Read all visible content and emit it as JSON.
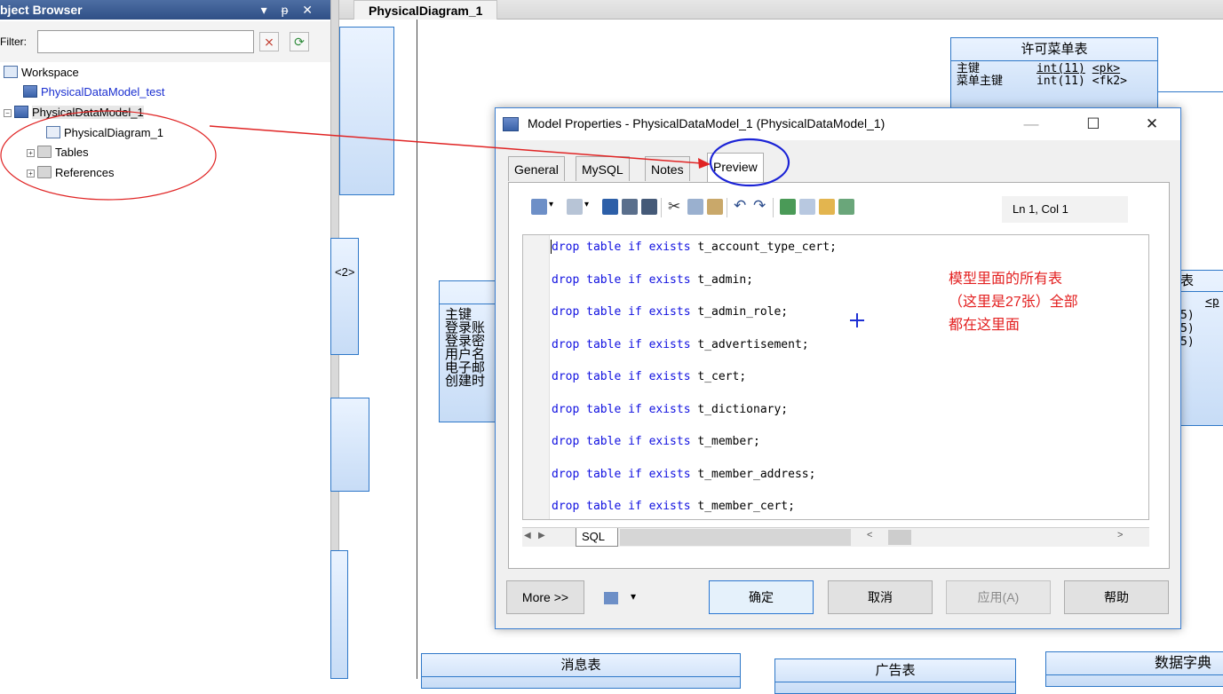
{
  "object_browser": {
    "title": "bject Browser",
    "title_controls": "▾ ᵽ ✕",
    "filter_label": "Filter:",
    "filter_value": "",
    "tree": [
      {
        "label": "Workspace",
        "style": "normal"
      },
      {
        "label": "PhysicalDataModel_test",
        "style": "blue"
      },
      {
        "label": "PhysicalDataModel_1",
        "style": "selected"
      },
      {
        "label": "PhysicalDiagram_1",
        "style": "normal"
      },
      {
        "label": "Tables",
        "style": "normal"
      },
      {
        "label": "References",
        "style": "normal"
      }
    ]
  },
  "diagram": {
    "tab_label": "PhysicalDiagram_1",
    "entities": {
      "permission_menu": {
        "title": "许可菜单表",
        "rows": [
          {
            "name": "主键",
            "type": "int(11)",
            "key": "<pk>"
          },
          {
            "name": "菜单主键",
            "type": "int(11)",
            "key": "<fk2>"
          }
        ]
      },
      "admin": {
        "rows": [
          "主键",
          "登录账",
          "登录密",
          "用户名",
          "电子邮",
          "创建时"
        ]
      },
      "right_partial": {
        "title": "表",
        "rows": [
          "<p",
          "5)",
          "5)",
          "5)"
        ]
      },
      "message": {
        "title": "消息表"
      },
      "advert": {
        "title": "广告表"
      },
      "dictionary": {
        "title": "数据字典"
      },
      "left_fragment": {
        "text": "<2>"
      }
    }
  },
  "dialog": {
    "title": "Model Properties - PhysicalDataModel_1 (PhysicalDataModel_1)",
    "minimize": "—",
    "maximize": "☐",
    "close": "✕",
    "tabs": [
      "General",
      "MySQL",
      "Notes",
      "Preview"
    ],
    "active_tab": "Preview",
    "line_col": "Ln 1, Col 1",
    "sql_lines": [
      {
        "keyword": "drop table if exists",
        "name": " t_account_type_cert;"
      },
      {
        "keyword": "drop table if exists",
        "name": " t_admin;"
      },
      {
        "keyword": "drop table if exists",
        "name": " t_admin_role;"
      },
      {
        "keyword": "drop table if exists",
        "name": " t_advertisement;"
      },
      {
        "keyword": "drop table if exists",
        "name": " t_cert;"
      },
      {
        "keyword": "drop table if exists",
        "name": " t_dictionary;"
      },
      {
        "keyword": "drop table if exists",
        "name": " t_member;"
      },
      {
        "keyword": "drop table if exists",
        "name": " t_member_address;"
      },
      {
        "keyword": "drop table if exists",
        "name": " t_member_cert;"
      }
    ],
    "sql_tab": "SQL",
    "buttons": {
      "more": "More >>",
      "ok": "确定",
      "cancel": "取消",
      "apply": "应用(A)",
      "help": "帮助"
    }
  },
  "annotation": {
    "lines": [
      "模型里面的所有表",
      "（这里是27张）全部",
      "都在这里面"
    ],
    "color": "#e32020"
  }
}
